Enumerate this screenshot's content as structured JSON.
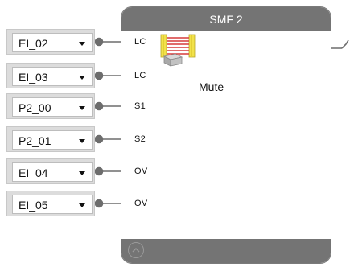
{
  "block": {
    "title": "SMF 2",
    "function_label": "Mute",
    "icon": "muting-light-curtain-icon"
  },
  "inputs": [
    {
      "value": "EI_02",
      "pin": "LC"
    },
    {
      "value": "EI_03",
      "pin": "LC"
    },
    {
      "value": "P2_00",
      "pin": "S1"
    },
    {
      "value": "P2_01",
      "pin": "S2"
    },
    {
      "value": "EI_04",
      "pin": "OV"
    },
    {
      "value": "EI_05",
      "pin": "OV"
    }
  ],
  "colors": {
    "header": "#747474",
    "wire": "#6d6d6d",
    "curtain_red": "#d63b3b",
    "curtain_yellow": "#f2e24a"
  }
}
